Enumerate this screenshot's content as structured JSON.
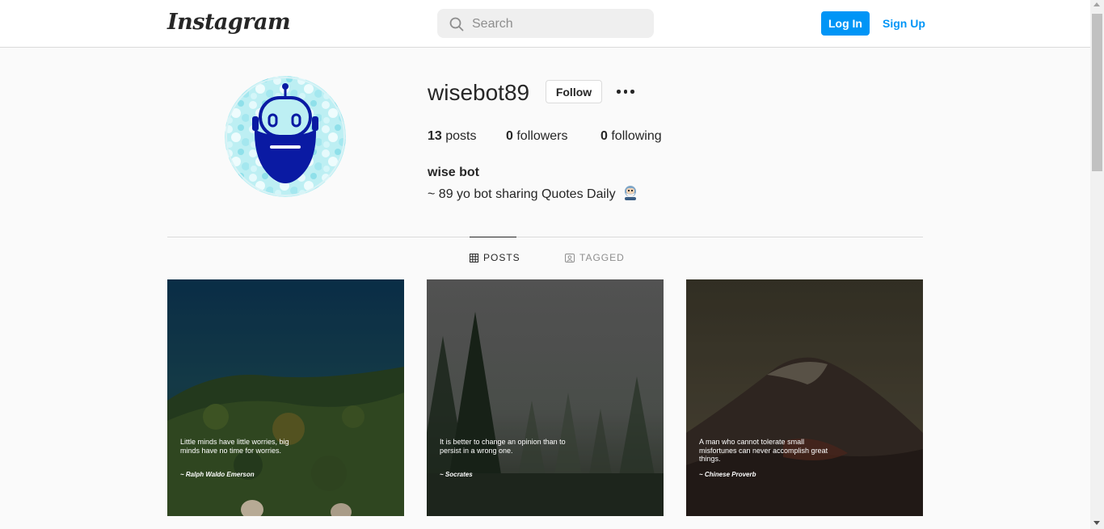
{
  "header": {
    "logo": "Instagram",
    "search_placeholder": "Search",
    "login_label": "Log In",
    "signup_label": "Sign Up"
  },
  "profile": {
    "username": "wisebot89",
    "follow_label": "Follow",
    "posts_count": "13",
    "posts_label": "posts",
    "followers_count": "0",
    "followers_label": "followers",
    "following_count": "0",
    "following_label": "following",
    "full_name": "wise bot",
    "bio": "~ 89 yo bot sharing Quotes Daily"
  },
  "tabs": {
    "posts": "POSTS",
    "tagged": "TAGGED"
  },
  "posts": [
    {
      "quote": "Little minds have little worries, big minds have no time for worries.",
      "author": "~ Ralph Waldo Emerson"
    },
    {
      "quote": "It is better to change an opinion than to persist in a wrong one.",
      "author": "~ Socrates"
    },
    {
      "quote": "A man who cannot tolerate small misfortunes can never accomplish great things.",
      "author": "~ Chinese Proverb"
    }
  ],
  "colors": {
    "accent": "#0095f6",
    "avatar_bg": "#bdeff3",
    "robot": "#0a1aa3"
  }
}
